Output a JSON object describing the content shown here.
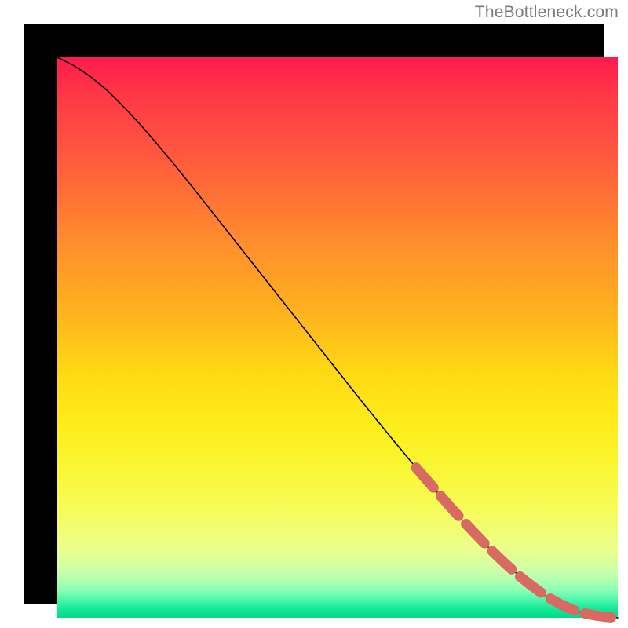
{
  "watermark": "TheBottleneck.com",
  "chart_data": {
    "type": "line",
    "title": "",
    "xlabel": "",
    "ylabel": "",
    "xlim": [
      0,
      100
    ],
    "ylim": [
      0,
      100
    ],
    "grid": false,
    "legend": false,
    "series": [
      {
        "name": "curve",
        "color": "#000000",
        "x": [
          0,
          3,
          6,
          9,
          12,
          15,
          18,
          21,
          24,
          27,
          30,
          33,
          36,
          39,
          42,
          45,
          48,
          51,
          54,
          57,
          60,
          63,
          66,
          69,
          72,
          75,
          78,
          81,
          84,
          86,
          88,
          90,
          92,
          94,
          96,
          98,
          100
        ],
        "y": [
          100,
          98.5,
          96.5,
          94,
          91,
          87.8,
          84.3,
          80.7,
          77,
          73.2,
          69.4,
          65.6,
          61.8,
          58,
          54.2,
          50.4,
          46.6,
          42.8,
          39,
          35.3,
          31.6,
          28,
          24.5,
          21,
          17.7,
          14.5,
          11.5,
          8.7,
          6.2,
          4.7,
          3.4,
          2.3,
          1.4,
          0.8,
          0.4,
          0.15,
          0
        ]
      },
      {
        "name": "highlight-dashes",
        "color": "#d96a63",
        "style": "dashed",
        "x": [
          64,
          66,
          68,
          70,
          72,
          74,
          76,
          78,
          80,
          82,
          84,
          86,
          88,
          90,
          92,
          94,
          96,
          98,
          100
        ],
        "y": [
          26.8,
          24.5,
          22.2,
          19.9,
          17.7,
          15.6,
          13.5,
          11.5,
          9.6,
          7.8,
          6.2,
          4.7,
          3.4,
          2.3,
          1.4,
          0.8,
          0.4,
          0.15,
          0
        ]
      }
    ],
    "background_gradient": {
      "direction": "top-to-bottom",
      "stops": [
        {
          "pos": 0.0,
          "color": "#ff1a4d"
        },
        {
          "pos": 0.2,
          "color": "#ff6a36"
        },
        {
          "pos": 0.45,
          "color": "#ffc91a"
        },
        {
          "pos": 0.7,
          "color": "#fbf638"
        },
        {
          "pos": 0.9,
          "color": "#c7ffab"
        },
        {
          "pos": 1.0,
          "color": "#05d989"
        }
      ]
    }
  }
}
